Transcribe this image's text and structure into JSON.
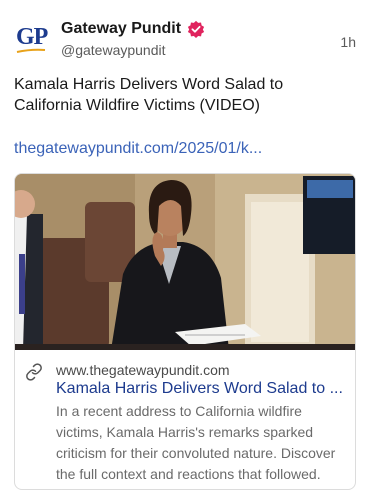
{
  "post": {
    "author": {
      "name": "Gateway Pundit",
      "handle": "@gatewaypundit",
      "avatar_text": "GP",
      "verified_icon": "verified-badge-icon"
    },
    "time": "1h",
    "text": "Kamala Harris Delivers Word Salad to California Wildfire Victims (VIDEO)",
    "link_text": "thegatewaypundit.com/2025/01/k..."
  },
  "card": {
    "domain": "www.thegatewaypundit.com",
    "title": "Kamala Harris Delivers Word Salad to ...",
    "description": "In a recent address to California wildfire victims, Kamala Harris's remarks sparked criticism for their convoluted nature. Discover the full context and reactions that followed.",
    "link_icon": "link-icon"
  },
  "colors": {
    "brand_blue": "#1d3b8e",
    "link_blue": "#3b63b8",
    "verified_pink": "#e0245e",
    "muted_text": "#5a5a5a"
  }
}
